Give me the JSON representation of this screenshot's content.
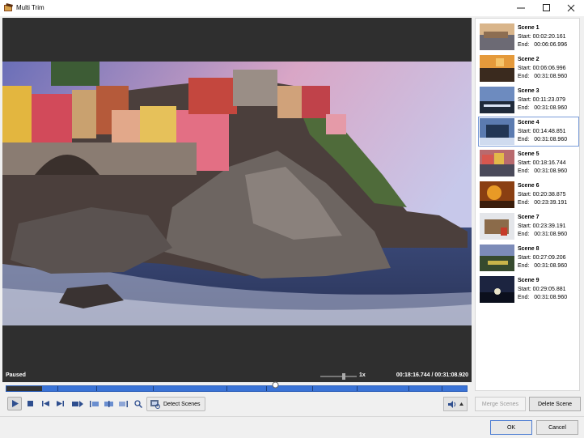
{
  "window": {
    "title": "Multi Trim"
  },
  "player": {
    "status": "Paused",
    "speed": "1x",
    "time": "00:18:16.744  /  00:31:08.920",
    "progress_fraction": 0.587
  },
  "controls": {
    "detect_scenes_label": "Detect Scenes"
  },
  "scenes": [
    {
      "name": "Scene 1",
      "start": "Start: 00:02:20.161",
      "end": "End:   00:06:06.996"
    },
    {
      "name": "Scene 2",
      "start": "Start: 00:06:06.996",
      "end": "End:   00:31:08.960"
    },
    {
      "name": "Scene 3",
      "start": "Start: 00:11:23.079",
      "end": "End:   00:31:08.960"
    },
    {
      "name": "Scene 4",
      "start": "Start: 00:14:48.851",
      "end": "End:   00:31:08.960"
    },
    {
      "name": "Scene 5",
      "start": "Start: 00:18:16.744",
      "end": "End:   00:31:08.960"
    },
    {
      "name": "Scene 6",
      "start": "Start: 00:20:38.875",
      "end": "End:   00:23:39.191"
    },
    {
      "name": "Scene 7",
      "start": "Start: 00:23:39.191",
      "end": "End:   00:31:08.960"
    },
    {
      "name": "Scene 8",
      "start": "Start: 00:27:09.206",
      "end": "End:   00:31:08.960"
    },
    {
      "name": "Scene 9",
      "start": "Start: 00:29:05.881",
      "end": "End:   00:31:08.960"
    }
  ],
  "selected_scene_index": 3,
  "buttons": {
    "merge": "Merge Scenes",
    "delete": "Delete Scene",
    "ok": "OK",
    "cancel": "Cancel"
  },
  "colors": {
    "timeline": "#3a73d6",
    "video_bg": "#2f2f2f",
    "selected_border": "#7a9cd8"
  }
}
